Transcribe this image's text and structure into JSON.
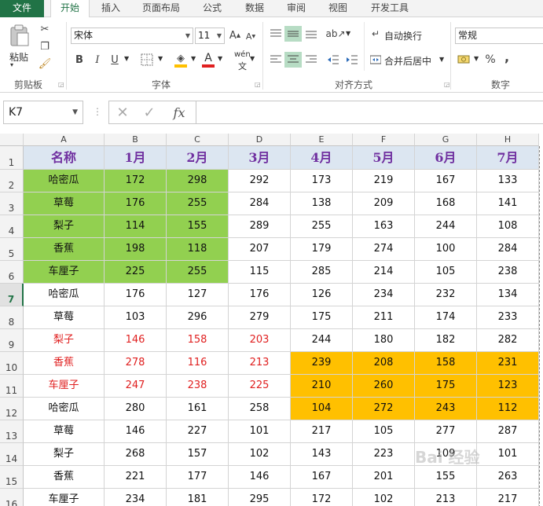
{
  "tabs": [
    "文件",
    "开始",
    "插入",
    "页面布局",
    "公式",
    "数据",
    "审阅",
    "视图",
    "开发工具"
  ],
  "ribbon": {
    "groups": {
      "clipboard": "剪贴板",
      "font": "字体",
      "alignment": "对齐方式",
      "number": "数字"
    },
    "paste_label": "粘贴",
    "font_name": "宋体",
    "font_size": "11",
    "wrap_text": "自动换行",
    "merge_center": "合并后居中",
    "number_format": "常规",
    "bold": "B",
    "italic": "I",
    "underline": "U",
    "grow_font": "A",
    "shrink_font": "A",
    "font_color_letter": "A",
    "phonetic": "wén",
    "percent": "%",
    "comma": ","
  },
  "formula_bar": {
    "name_box": "K7",
    "fx": "fx",
    "formula": ""
  },
  "colors": {
    "accent": "#217346",
    "header_fill": "#dce6f1",
    "header_text": "#7030a0",
    "green_fill": "#92d050",
    "orange_fill": "#ffc000",
    "red_text": "#e02020"
  },
  "columns": [
    "A",
    "B",
    "C",
    "D",
    "E",
    "F",
    "G",
    "H"
  ],
  "rows": [
    [
      "名称",
      "1月",
      "2月",
      "3月",
      "4月",
      "5月",
      "6月",
      "7月"
    ],
    [
      "哈密瓜",
      "172",
      "298",
      "292",
      "173",
      "219",
      "167",
      "133"
    ],
    [
      "草莓",
      "176",
      "255",
      "284",
      "138",
      "209",
      "168",
      "141"
    ],
    [
      "梨子",
      "114",
      "155",
      "289",
      "255",
      "163",
      "244",
      "108"
    ],
    [
      "香蕉",
      "198",
      "118",
      "207",
      "179",
      "274",
      "100",
      "284"
    ],
    [
      "车厘子",
      "225",
      "255",
      "115",
      "285",
      "214",
      "105",
      "238"
    ],
    [
      "哈密瓜",
      "176",
      "127",
      "176",
      "126",
      "234",
      "232",
      "134"
    ],
    [
      "草莓",
      "103",
      "296",
      "279",
      "175",
      "211",
      "174",
      "233"
    ],
    [
      "梨子",
      "146",
      "158",
      "203",
      "244",
      "180",
      "182",
      "282"
    ],
    [
      "香蕉",
      "278",
      "116",
      "213",
      "239",
      "208",
      "158",
      "231"
    ],
    [
      "车厘子",
      "247",
      "238",
      "225",
      "210",
      "260",
      "175",
      "123"
    ],
    [
      "哈密瓜",
      "280",
      "161",
      "258",
      "104",
      "272",
      "243",
      "112"
    ],
    [
      "草莓",
      "146",
      "227",
      "101",
      "217",
      "105",
      "277",
      "287"
    ],
    [
      "梨子",
      "268",
      "157",
      "102",
      "143",
      "223",
      "109",
      "101"
    ],
    [
      "香蕉",
      "221",
      "177",
      "146",
      "167",
      "201",
      "155",
      "263"
    ],
    [
      "车厘子",
      "234",
      "181",
      "295",
      "172",
      "102",
      "213",
      "217"
    ]
  ],
  "selected_row": 7,
  "watermark": "Bai 经验"
}
